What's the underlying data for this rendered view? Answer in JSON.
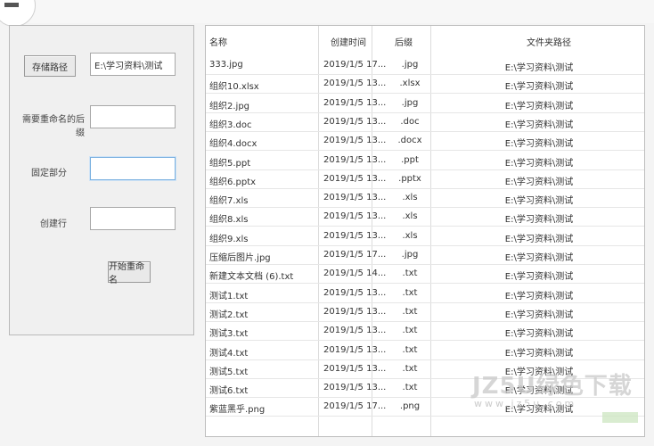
{
  "left": {
    "store_path_button": "存储路径",
    "store_path_value": "E:\\学习资料\\测试",
    "rename_label": "需要重命名的后缀",
    "fixed_label": "固定部分",
    "start_label": "创建行",
    "start_button": "开始重命名"
  },
  "grid": {
    "headers": {
      "name": "名称",
      "created": "创建时间",
      "ext": "后缀",
      "folder": "文件夹路径"
    },
    "rows": [
      {
        "name": "333.jpg",
        "created": "2019/1/5 17...",
        "ext": ".jpg",
        "folder": "E:\\学习资料\\测试"
      },
      {
        "name": "组织10.xlsx",
        "created": "2019/1/5 13...",
        "ext": ".xlsx",
        "folder": "E:\\学习资料\\测试"
      },
      {
        "name": "组织2.jpg",
        "created": "2019/1/5 13...",
        "ext": ".jpg",
        "folder": "E:\\学习资料\\测试"
      },
      {
        "name": "组织3.doc",
        "created": "2019/1/5 13...",
        "ext": ".doc",
        "folder": "E:\\学习资料\\测试"
      },
      {
        "name": "组织4.docx",
        "created": "2019/1/5 13...",
        "ext": ".docx",
        "folder": "E:\\学习资料\\测试"
      },
      {
        "name": "组织5.ppt",
        "created": "2019/1/5 13...",
        "ext": ".ppt",
        "folder": "E:\\学习资料\\测试"
      },
      {
        "name": "组织6.pptx",
        "created": "2019/1/5 13...",
        "ext": ".pptx",
        "folder": "E:\\学习资料\\测试"
      },
      {
        "name": "组织7.xls",
        "created": "2019/1/5 13...",
        "ext": ".xls",
        "folder": "E:\\学习资料\\测试"
      },
      {
        "name": "组织8.xls",
        "created": "2019/1/5 13...",
        "ext": ".xls",
        "folder": "E:\\学习资料\\测试"
      },
      {
        "name": "组织9.xls",
        "created": "2019/1/5 13...",
        "ext": ".xls",
        "folder": "E:\\学习资料\\测试"
      },
      {
        "name": "压缩后图片.jpg",
        "created": "2019/1/5 17...",
        "ext": ".jpg",
        "folder": "E:\\学习资料\\测试"
      },
      {
        "name": "新建文本文档 (6).txt",
        "created": "2019/1/5 14...",
        "ext": ".txt",
        "folder": "E:\\学习资料\\测试"
      },
      {
        "name": "测试1.txt",
        "created": "2019/1/5 13...",
        "ext": ".txt",
        "folder": "E:\\学习资料\\测试"
      },
      {
        "name": "测试2.txt",
        "created": "2019/1/5 13...",
        "ext": ".txt",
        "folder": "E:\\学习资料\\测试"
      },
      {
        "name": "测试3.txt",
        "created": "2019/1/5 13...",
        "ext": ".txt",
        "folder": "E:\\学习资料\\测试"
      },
      {
        "name": "测试4.txt",
        "created": "2019/1/5 13...",
        "ext": ".txt",
        "folder": "E:\\学习资料\\测试"
      },
      {
        "name": "测试5.txt",
        "created": "2019/1/5 13...",
        "ext": ".txt",
        "folder": "E:\\学习资料\\测试"
      },
      {
        "name": "测试6.txt",
        "created": "2019/1/5 13...",
        "ext": ".txt",
        "folder": "E:\\学习资料\\测试"
      },
      {
        "name": "紫蓝黑乎.png",
        "created": "2019/1/5 17...",
        "ext": ".png",
        "folder": "E:\\学习资料\\测试"
      }
    ]
  },
  "watermark": {
    "text": "JZ5U绿色下载",
    "url": "www.jz5u.com"
  }
}
